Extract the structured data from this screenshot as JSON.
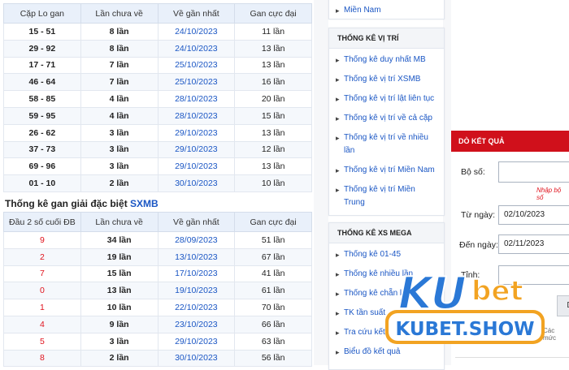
{
  "table1": {
    "headers": [
      "Cặp Lo gan",
      "Lần chưa về",
      "Về gần nhất",
      "Gan cực đại"
    ],
    "rows": [
      [
        "15 - 51",
        "8 lần",
        "24/10/2023",
        "11 lần"
      ],
      [
        "29 - 92",
        "8 lần",
        "24/10/2023",
        "13 lần"
      ],
      [
        "17 - 71",
        "7 lần",
        "25/10/2023",
        "13 lần"
      ],
      [
        "46 - 64",
        "7 lần",
        "25/10/2023",
        "16 lần"
      ],
      [
        "58 - 85",
        "4 lần",
        "28/10/2023",
        "20 lần"
      ],
      [
        "59 - 95",
        "4 lần",
        "28/10/2023",
        "15 lần"
      ],
      [
        "26 - 62",
        "3 lần",
        "29/10/2023",
        "13 lần"
      ],
      [
        "37 - 73",
        "3 lần",
        "29/10/2023",
        "12 lần"
      ],
      [
        "69 - 96",
        "3 lần",
        "29/10/2023",
        "13 lần"
      ],
      [
        "01 - 10",
        "2 lần",
        "30/10/2023",
        "10 lần"
      ]
    ]
  },
  "section2": {
    "title_prefix": "Thống kê gan giải đặc biệt",
    "title_highlight": "SXMB"
  },
  "table2": {
    "headers": [
      "Đầu 2 số cuối ĐB",
      "Lần chưa về",
      "Về gần nhất",
      "Gan cực đại"
    ],
    "rows": [
      [
        "9",
        "34 lần",
        "28/09/2023",
        "51 lần"
      ],
      [
        "2",
        "19 lần",
        "13/10/2023",
        "67 lần"
      ],
      [
        "7",
        "15 lần",
        "17/10/2023",
        "41 lần"
      ],
      [
        "0",
        "13 lần",
        "19/10/2023",
        "61 lần"
      ],
      [
        "1",
        "10 lần",
        "22/10/2023",
        "70 lần"
      ],
      [
        "4",
        "9 lần",
        "23/10/2023",
        "66 lần"
      ],
      [
        "5",
        "3 lần",
        "29/10/2023",
        "63 lần"
      ],
      [
        "8",
        "2 lần",
        "30/10/2023",
        "56 lần"
      ]
    ]
  },
  "sidebar": {
    "top_item": "Miền Nam",
    "vitri": {
      "header": "THỐNG KÊ VỊ TRÍ",
      "items": [
        "Thống kê duy nhất MB",
        "Thống kê vị trí XSMB",
        "Thống kê vị trí lật liên tục",
        "Thống kê vị trí về cả cặp",
        "Thống kê vị trí về nhiều lần",
        "Thống kê vị trí Miền Nam",
        "Thống kê vị trí Miền Trung"
      ]
    },
    "mega": {
      "header": "THỐNG KÊ XS MEGA",
      "items": [
        "Thống kê 01-45",
        "Thống kê nhiều lần",
        "Thống kê chẵn lẻ",
        "TK tần suất",
        "Tra cứu kết quả",
        "Biểu đồ kết quả"
      ]
    }
  },
  "form": {
    "header": "DÒ KẾT QUẢ",
    "boso_label": "Bộ số:",
    "boso_hint": "Nhập bộ số",
    "tungay_label": "Từ ngày:",
    "tungay_value": "02/10/2023",
    "denngay_label": "Đến ngày:",
    "denngay_value": "02/11/2023",
    "tinh_label": "Tỉnh:",
    "button_label": "D",
    "note1": "Các mức"
  },
  "logo": {
    "ku": "KU",
    "bet": "bet",
    "site": "KUBET.SHOW"
  },
  "colors": {
    "accent_red": "#d0101b",
    "link_blue": "#1a56c4",
    "logo_blue": "#2a78d6",
    "logo_orange": "#f2a322"
  }
}
